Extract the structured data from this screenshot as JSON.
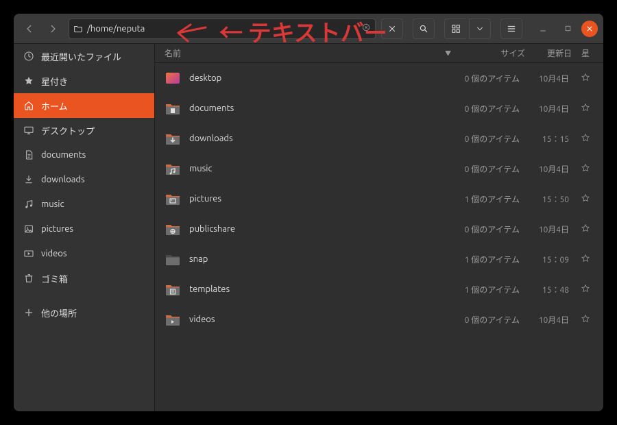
{
  "path": "/home/neputa",
  "annotation": "← テキストバー",
  "sidebar": {
    "items": [
      {
        "icon": "clock",
        "label": "最近開いたファイル"
      },
      {
        "icon": "star",
        "label": "星付き"
      },
      {
        "icon": "home",
        "label": "ホーム",
        "selected": true
      },
      {
        "icon": "desktop",
        "label": "デスクトップ"
      },
      {
        "icon": "documents",
        "label": "documents"
      },
      {
        "icon": "downloads",
        "label": "downloads"
      },
      {
        "icon": "music",
        "label": "music"
      },
      {
        "icon": "pictures",
        "label": "pictures"
      },
      {
        "icon": "videos",
        "label": "videos"
      },
      {
        "icon": "trash",
        "label": "ゴミ箱"
      },
      {
        "icon": "plus",
        "label": "他の場所"
      }
    ]
  },
  "columns": {
    "name": "名前",
    "size": "サイズ",
    "modified": "更新日",
    "star": "星"
  },
  "files": [
    {
      "icon": "desktop-folder",
      "name": "desktop",
      "size": "0 個のアイテム",
      "modified": "10月4日"
    },
    {
      "icon": "documents-folder",
      "name": "documents",
      "size": "0 個のアイテム",
      "modified": "10月4日"
    },
    {
      "icon": "downloads-folder",
      "name": "downloads",
      "size": "0 個のアイテム",
      "modified": "15：15"
    },
    {
      "icon": "music-folder",
      "name": "music",
      "size": "0 個のアイテム",
      "modified": "10月4日"
    },
    {
      "icon": "pictures-folder",
      "name": "pictures",
      "size": "1 個のアイテム",
      "modified": "15：50"
    },
    {
      "icon": "public-folder",
      "name": "publicshare",
      "size": "0 個のアイテム",
      "modified": "10月4日"
    },
    {
      "icon": "folder",
      "name": "snap",
      "size": "1 個のアイテム",
      "modified": "15：09"
    },
    {
      "icon": "templates-folder",
      "name": "templates",
      "size": "1 個のアイテム",
      "modified": "15：48"
    },
    {
      "icon": "videos-folder",
      "name": "videos",
      "size": "0 個のアイテム",
      "modified": "10月4日"
    }
  ]
}
